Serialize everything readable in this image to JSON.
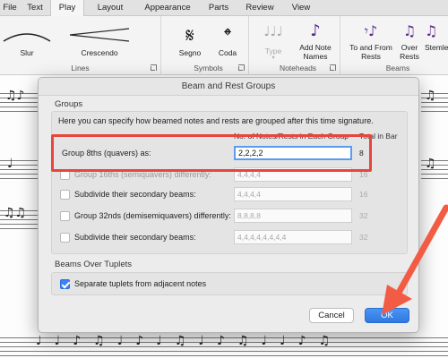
{
  "tabs": [
    "File",
    "Text",
    "Play",
    "Layout",
    "Appearance",
    "Parts",
    "Review",
    "View"
  ],
  "ribbon": {
    "lines": {
      "slur": "Slur",
      "crescendo": "Crescendo",
      "group": "Lines"
    },
    "symbols": {
      "segno": "Segno",
      "coda": "Coda",
      "group": "Symbols"
    },
    "noteheads": {
      "type": "Type",
      "add_note_names": "Add Note Names",
      "group": "Noteheads"
    },
    "beams": {
      "to_from_rests": "To and From Rests",
      "over_rests": "Over Rests",
      "stemlets": "Stemle",
      "group": "Beams"
    }
  },
  "dialog": {
    "title": "Beam and Rest Groups",
    "groups_label": "Groups",
    "intro": "Here you can specify how beamed notes and rests are grouped after this time signature.",
    "col_notes": "No. of Notes/Rests in Each Group",
    "col_total": "Total in Bar",
    "rows": [
      {
        "label": "Group 8ths (quavers) as:",
        "value": "2,2,2,2",
        "total": "8",
        "checked": false,
        "active": true
      },
      {
        "label": "Group 16ths (semiquavers) differently:",
        "value": "4,4,4,4",
        "total": "16",
        "checked": false,
        "active": false
      },
      {
        "label": "Subdivide their secondary beams:",
        "value": "4,4,4,4",
        "total": "16",
        "checked": false,
        "active": false
      },
      {
        "label": "Group 32nds (demisemiquavers) differently:",
        "value": "8,8,8,8",
        "total": "32",
        "checked": false,
        "active": false
      },
      {
        "label": "Subdivide their secondary beams:",
        "value": "4,4,4,4,4,4,4,4",
        "total": "32",
        "checked": false,
        "active": false
      }
    ],
    "tuplets_label": "Beams Over Tuplets",
    "tuplets_option": "Separate tuplets from adjacent notes",
    "cancel": "Cancel",
    "ok": "OK"
  },
  "colors": {
    "highlight": "#e8453c",
    "accent": "#3b82f6"
  }
}
